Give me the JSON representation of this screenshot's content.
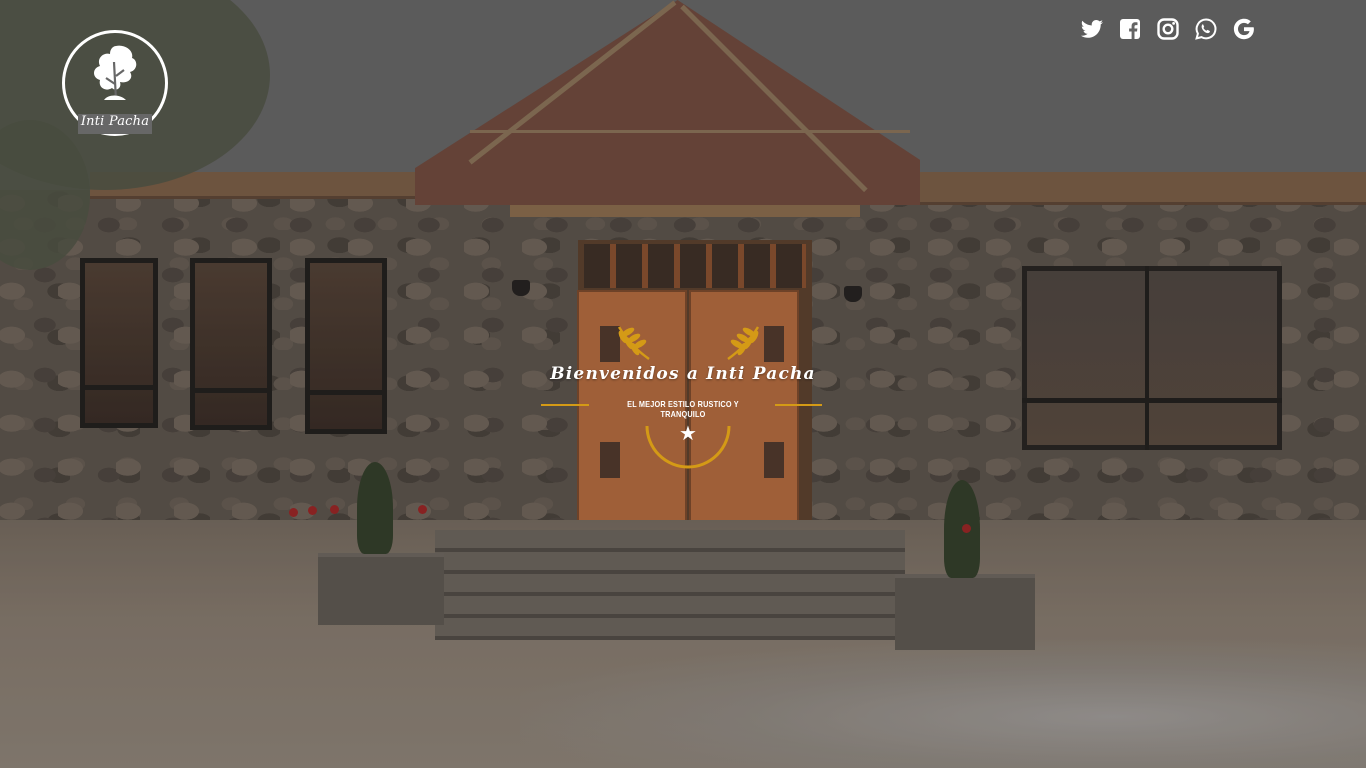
{
  "brand": {
    "logo_name": "Inti Pacha"
  },
  "social": {
    "items": [
      {
        "icon": "twitter-icon",
        "name": "Twitter"
      },
      {
        "icon": "facebook-icon",
        "name": "Facebook"
      },
      {
        "icon": "instagram-icon",
        "name": "Instagram"
      },
      {
        "icon": "whatsapp-icon",
        "name": "WhatsApp"
      },
      {
        "icon": "google-icon",
        "name": "Google"
      }
    ],
    "color": "#ffffff"
  },
  "hero": {
    "title": "Bienvenidos a Inti Pacha",
    "subtitle": "EL MEJOR ESTILO RUSTICO Y TRANQUILO",
    "star": "★",
    "accent_color": "#d49a16"
  }
}
